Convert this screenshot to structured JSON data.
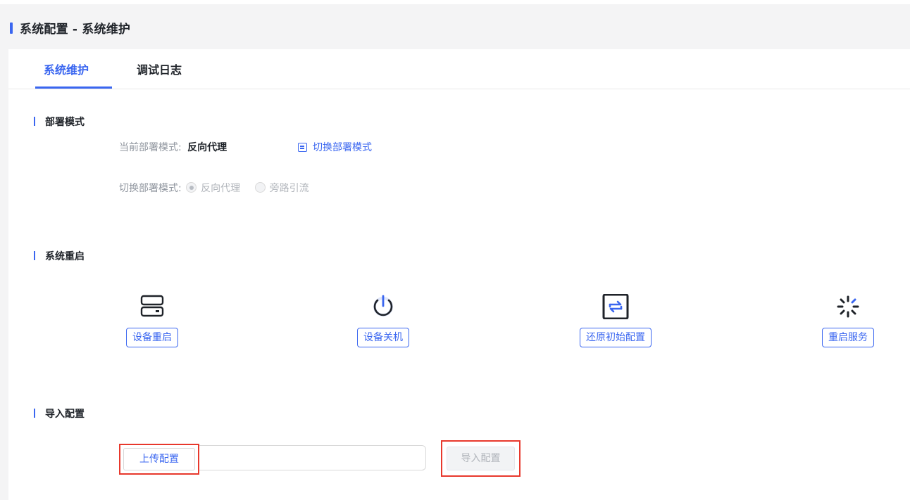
{
  "header": {
    "title": "系统配置 - 系统维护"
  },
  "tabs": [
    {
      "label": "系统维护",
      "active": true
    },
    {
      "label": "调试日志",
      "active": false
    }
  ],
  "deploy": {
    "section_title": "部署模式",
    "current_label": "当前部署模式:",
    "current_value": "反向代理",
    "switch_link": "切换部署模式",
    "switch_label": "切换部署模式:",
    "options": [
      {
        "label": "反向代理",
        "checked": true
      },
      {
        "label": "旁路引流",
        "checked": false
      }
    ]
  },
  "restart": {
    "section_title": "系统重启",
    "actions": [
      {
        "label": "设备重启",
        "icon": "server-icon"
      },
      {
        "label": "设备关机",
        "icon": "power-icon"
      },
      {
        "label": "还原初始配置",
        "icon": "restore-icon"
      },
      {
        "label": "重启服务",
        "icon": "loading-icon"
      }
    ]
  },
  "import": {
    "section_title": "导入配置",
    "upload_label": "上传配置",
    "import_label": "导入配置"
  },
  "colors": {
    "accent": "#3a66f0",
    "highlight_box": "#e8382c",
    "muted_text": "#8f959e"
  }
}
